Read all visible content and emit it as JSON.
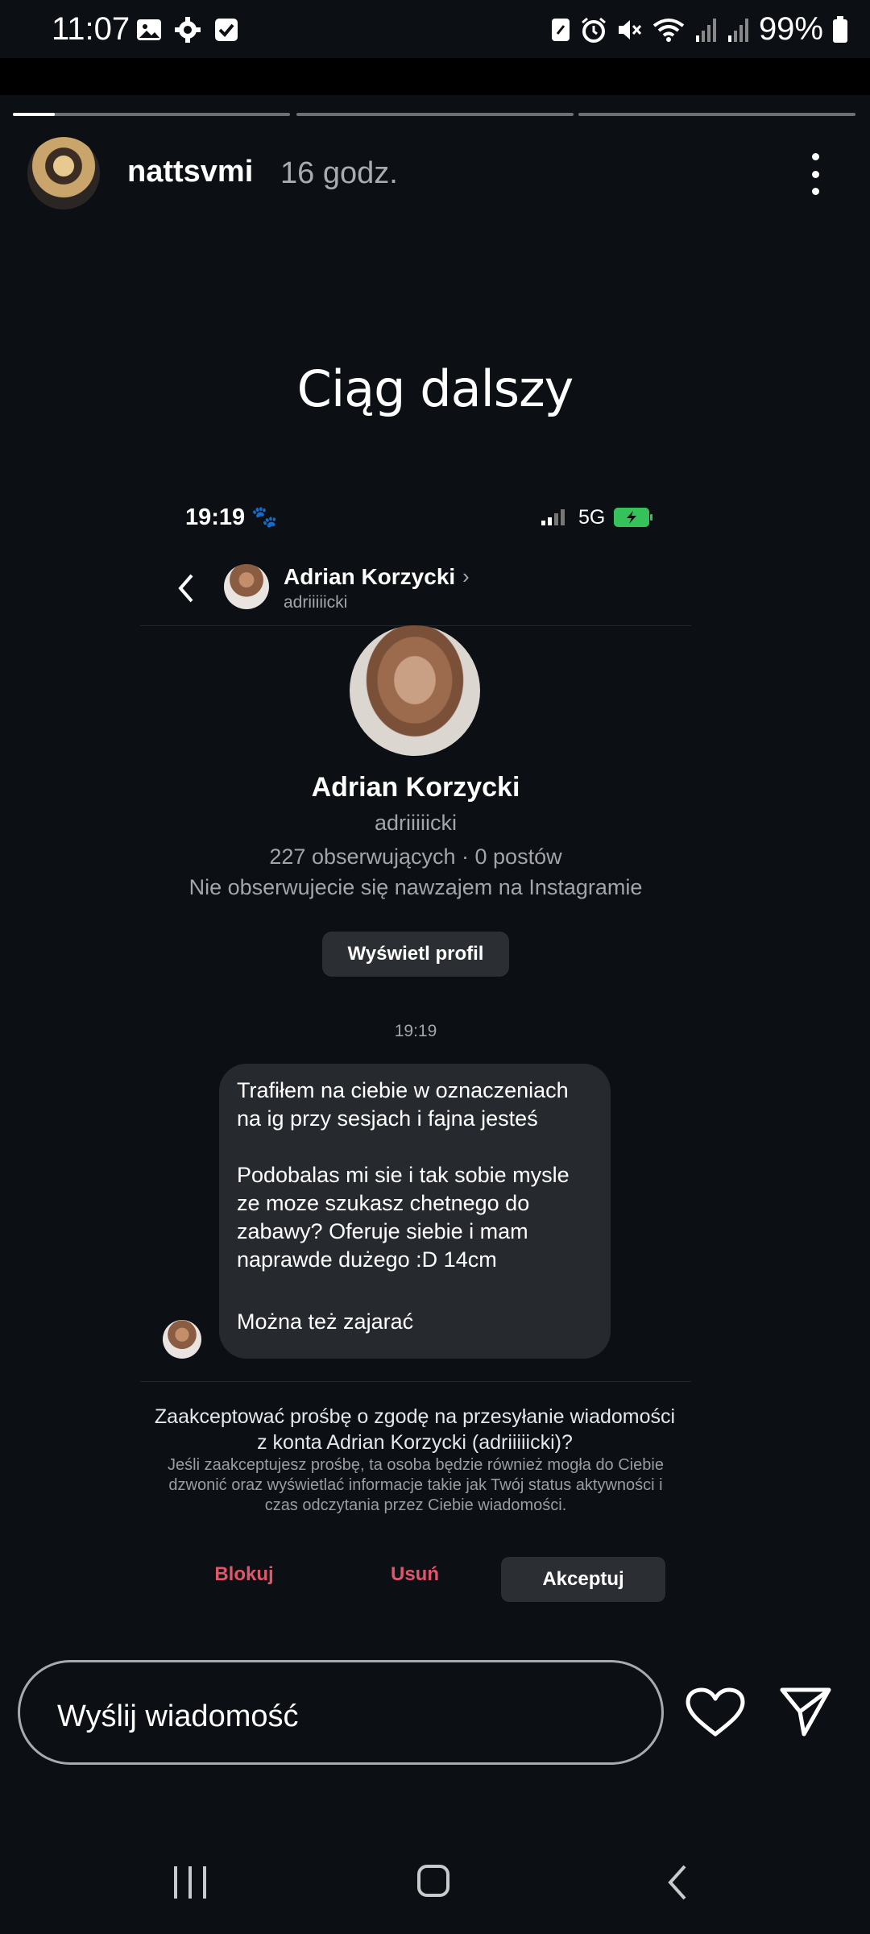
{
  "status_bar": {
    "time": "11:07",
    "left_icons": [
      "image-icon",
      "gear-icon",
      "checkbox-icon"
    ],
    "right_icons": [
      "nfc-icon",
      "alarm-icon",
      "mute-icon",
      "wifi-icon",
      "signal-icon",
      "signal-icon"
    ],
    "battery": "99%"
  },
  "story": {
    "segments": 3,
    "active_segment_progress": 0.15,
    "username": "nattsvmi",
    "time_ago": "16 godz.",
    "title": "Ciąg dalszy"
  },
  "inner_screenshot": {
    "time": "19:19",
    "network": "5G",
    "chat_name": "Adrian Korzycki",
    "chat_handle": "adriiiiicki",
    "profile_name": "Adrian Korzycki",
    "profile_handle": "adriiiiicki",
    "stats": "227 obserwujących · 0 postów",
    "mutual": "Nie obserwujecie się nawzajem na Instagramie",
    "view_profile": "Wyświetl profil",
    "message_time": "19:19",
    "message_lines": [
      "Trafiłem na ciebie w oznaczeniach",
      "na ig przy sesjach i fajna jesteś",
      "Podobalas mi sie i tak sobie mysle",
      "ze moze szukasz chetnego do",
      "zabawy? Oferuje siebie i mam",
      "naprawde dużego :D 14cm",
      "Można też zajarać"
    ],
    "request_title": "Zaakceptować prośbę o zgodę na przesyłanie wiadomości z konta Adrian Korzycki (adriiiiicki)?",
    "request_desc": "Jeśli zaakceptujesz prośbę, ta osoba będzie również mogła do Ciebie dzwonić oraz wyświetlać informacje takie jak Twój status aktywności i czas odczytania przez Ciebie wiadomości.",
    "block": "Blokuj",
    "delete": "Usuń",
    "accept": "Akceptuj"
  },
  "reply_bar": {
    "placeholder": "Wyślij wiadomość"
  },
  "colors": {
    "background": "#0c0f14",
    "danger": "#e0566b",
    "bubble": "#26292e"
  }
}
